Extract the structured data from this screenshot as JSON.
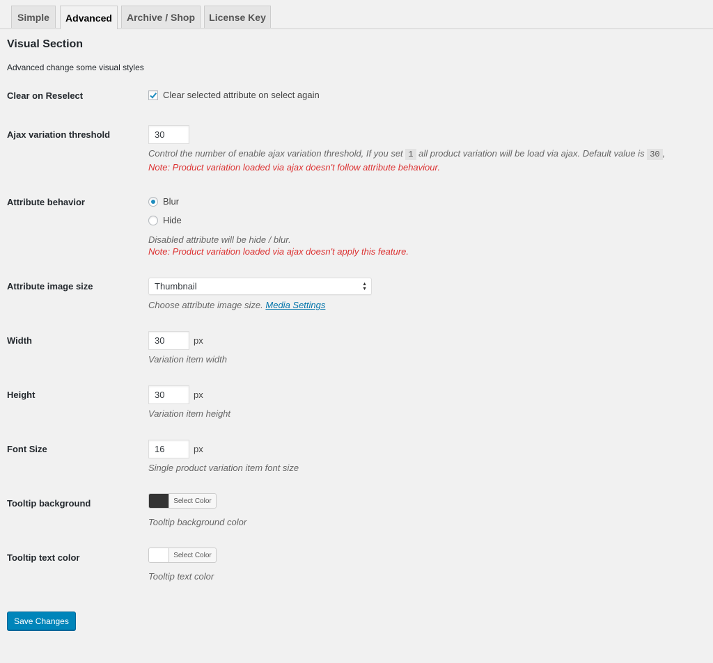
{
  "tabs": [
    "Simple",
    "Advanced",
    "Archive / Shop",
    "License Key"
  ],
  "section": {
    "title": "Visual Section",
    "description": "Advanced change some visual styles"
  },
  "clear_on_reselect": {
    "label": "Clear on Reselect",
    "checkbox_label": "Clear selected attribute on select again",
    "checked": true
  },
  "ajax_threshold": {
    "label": "Ajax variation threshold",
    "value": "30",
    "desc_part1": "Control the number of enable ajax variation threshold, If you set",
    "code1": "1",
    "desc_part2": "all product variation will be load via ajax. Default value is",
    "code2": "30",
    "desc_part3": ",",
    "note": "Note: Product variation loaded via ajax doesn't follow attribute behaviour."
  },
  "attribute_behavior": {
    "label": "Attribute behavior",
    "options": [
      "Blur",
      "Hide"
    ],
    "selected": "Blur",
    "desc": "Disabled attribute will be hide / blur.",
    "note": "Note: Product variation loaded via ajax doesn't apply this feature."
  },
  "image_size": {
    "label": "Attribute image size",
    "selected": "Thumbnail",
    "desc": "Choose attribute image size.",
    "link_text": "Media Settings"
  },
  "width": {
    "label": "Width",
    "value": "30",
    "unit": "px",
    "desc": "Variation item width"
  },
  "height": {
    "label": "Height",
    "value": "30",
    "unit": "px",
    "desc": "Variation item height"
  },
  "font_size": {
    "label": "Font Size",
    "value": "16",
    "unit": "px",
    "desc": "Single product variation item font size"
  },
  "tooltip_bg": {
    "label": "Tooltip background",
    "button": "Select Color",
    "color": "#333333",
    "desc": "Tooltip background color"
  },
  "tooltip_text": {
    "label": "Tooltip text color",
    "button": "Select Color",
    "color": "#ffffff",
    "desc": "Tooltip text color"
  },
  "save_label": "Save Changes",
  "colors": {
    "accent": "#0085ba",
    "note_red": "#dc3232",
    "link": "#0073aa"
  }
}
